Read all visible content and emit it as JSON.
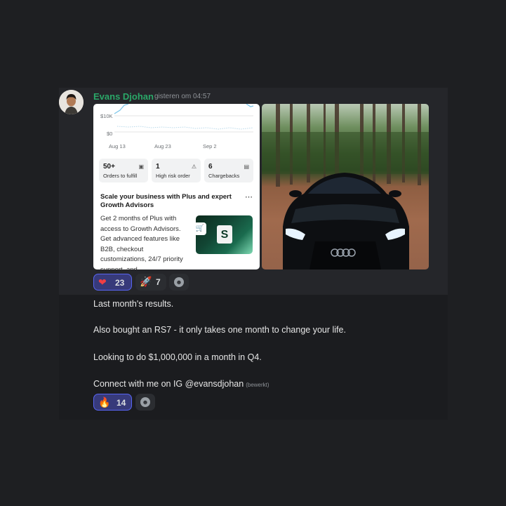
{
  "message": {
    "author": "Evans Djohan",
    "timestamp": "gisteren om 04:57",
    "lines": [
      "Last month's results.",
      "Also bought an RS7 - it only takes one month to change your life.",
      "Looking to do $1,000,000 in a month in Q4.",
      "Connect with me on IG @evansdjohan"
    ],
    "edited_label": "(bewerkt)"
  },
  "dashboard": {
    "chart_data": {
      "type": "line",
      "y_ticks": [
        "$10K",
        "$0"
      ],
      "x_ticks": [
        "Aug 13",
        "Aug 23",
        "Sep 2"
      ]
    },
    "stats": [
      {
        "value": "50+",
        "label": "Orders to fulfill",
        "icon": "inbox-icon"
      },
      {
        "value": "1",
        "label": "High risk order",
        "icon": "warning-icon"
      },
      {
        "value": "6",
        "label": "Chargebacks",
        "icon": "calendar-icon"
      }
    ],
    "promo_title": "Scale your business with Plus and expert Growth Advisors",
    "promo_body": "Get 2 months of Plus with access to Growth Advisors. Get advanced features like B2B, checkout customizations, 24/7 priority support, and",
    "accent": "#008060"
  },
  "reactions_top": [
    {
      "emoji": "❤",
      "count": "23",
      "color": "#f23f43"
    },
    {
      "emoji": "🚀",
      "count": "7"
    }
  ],
  "reactions_bottom": [
    {
      "emoji": "🔥",
      "count": "14"
    }
  ],
  "colors": {
    "background": "#1e1f22",
    "username": "#2aa768",
    "reaction_active": "#5865f2"
  }
}
